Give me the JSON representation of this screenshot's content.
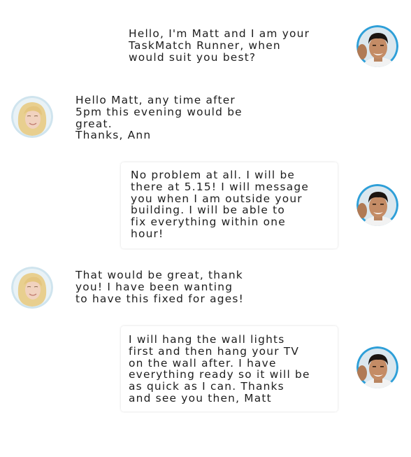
{
  "participants": {
    "runner": {
      "name": "Matt",
      "avatar_icon": "male-runner-avatar-icon",
      "ring_color": "#2e9fd8"
    },
    "customer": {
      "name": "Ann",
      "avatar_icon": "female-customer-avatar-icon",
      "ring_color": "#cfe4ee"
    }
  },
  "messages": [
    {
      "sender": "runner",
      "text": "Hello, I'm Matt and I am your\nTaskMatch Runner, when\nwould suit you best?"
    },
    {
      "sender": "customer",
      "text": "Hello Matt, any time after\n5pm this evening would be\ngreat.\nThanks, Ann"
    },
    {
      "sender": "runner",
      "text": "No problem at all. I will be\nthere at 5.15! I will message\nyou when I am outside your\nbuilding. I will be able to\nfix everything within one\nhour!"
    },
    {
      "sender": "customer",
      "text": "That would be great, thank\nyou! I have been wanting\nto have this fixed for ages!"
    },
    {
      "sender": "runner",
      "text": "I will hang the wall lights\nfirst and then hang your TV\non the wall after. I have\neverything ready so it will be\nas quick as I can. Thanks\nand see you then, Matt"
    }
  ]
}
